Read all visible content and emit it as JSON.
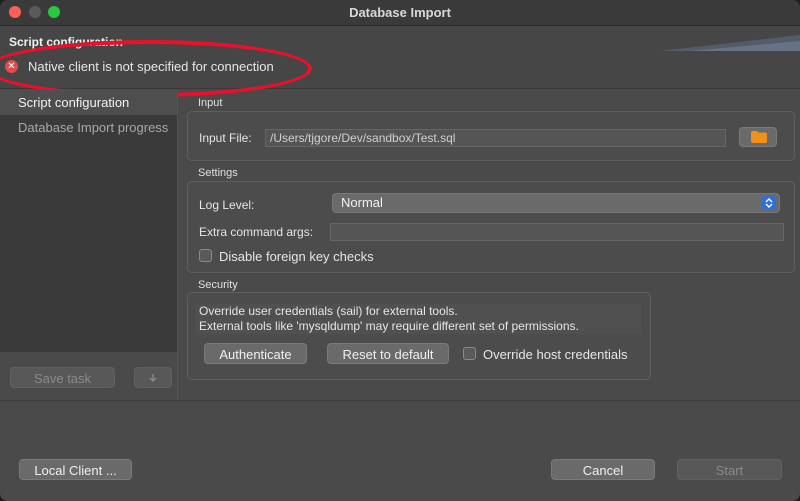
{
  "window": {
    "title": "Database Import"
  },
  "header": {
    "title": "Script configuration",
    "error_message": "Native client is not specified for connection"
  },
  "sidebar": {
    "items": [
      {
        "label": "Script configuration"
      },
      {
        "label": "Database Import progress"
      }
    ],
    "save_task_label": "Save task"
  },
  "input_group": {
    "label": "Input",
    "file_label": "Input File:",
    "file_value": "/Users/tjgore/Dev/sandbox/Test.sql"
  },
  "settings_group": {
    "label": "Settings",
    "log_level_label": "Log Level:",
    "log_level_value": "Normal",
    "extra_args_label": "Extra command args:",
    "extra_args_value": "",
    "disable_fk_label": "Disable foreign key checks"
  },
  "security_group": {
    "label": "Security",
    "line1": "Override user credentials (sail) for external tools.",
    "line2": "External tools like 'mysqldump' may require different set of permissions.",
    "authenticate_label": "Authenticate",
    "reset_label": "Reset to default",
    "override_host_label": "Override host credentials"
  },
  "footer": {
    "local_client_label": "Local Client ...",
    "cancel_label": "Cancel",
    "start_label": "Start"
  },
  "colors": {
    "error_icon": "#e24b4b",
    "annotation_circle": "#e8102a",
    "folder_icon": "#f0921a",
    "select_accent": "#2f6fd6"
  },
  "icons": [
    "error-icon",
    "folder-icon",
    "select-arrows-icon",
    "download-icon"
  ]
}
